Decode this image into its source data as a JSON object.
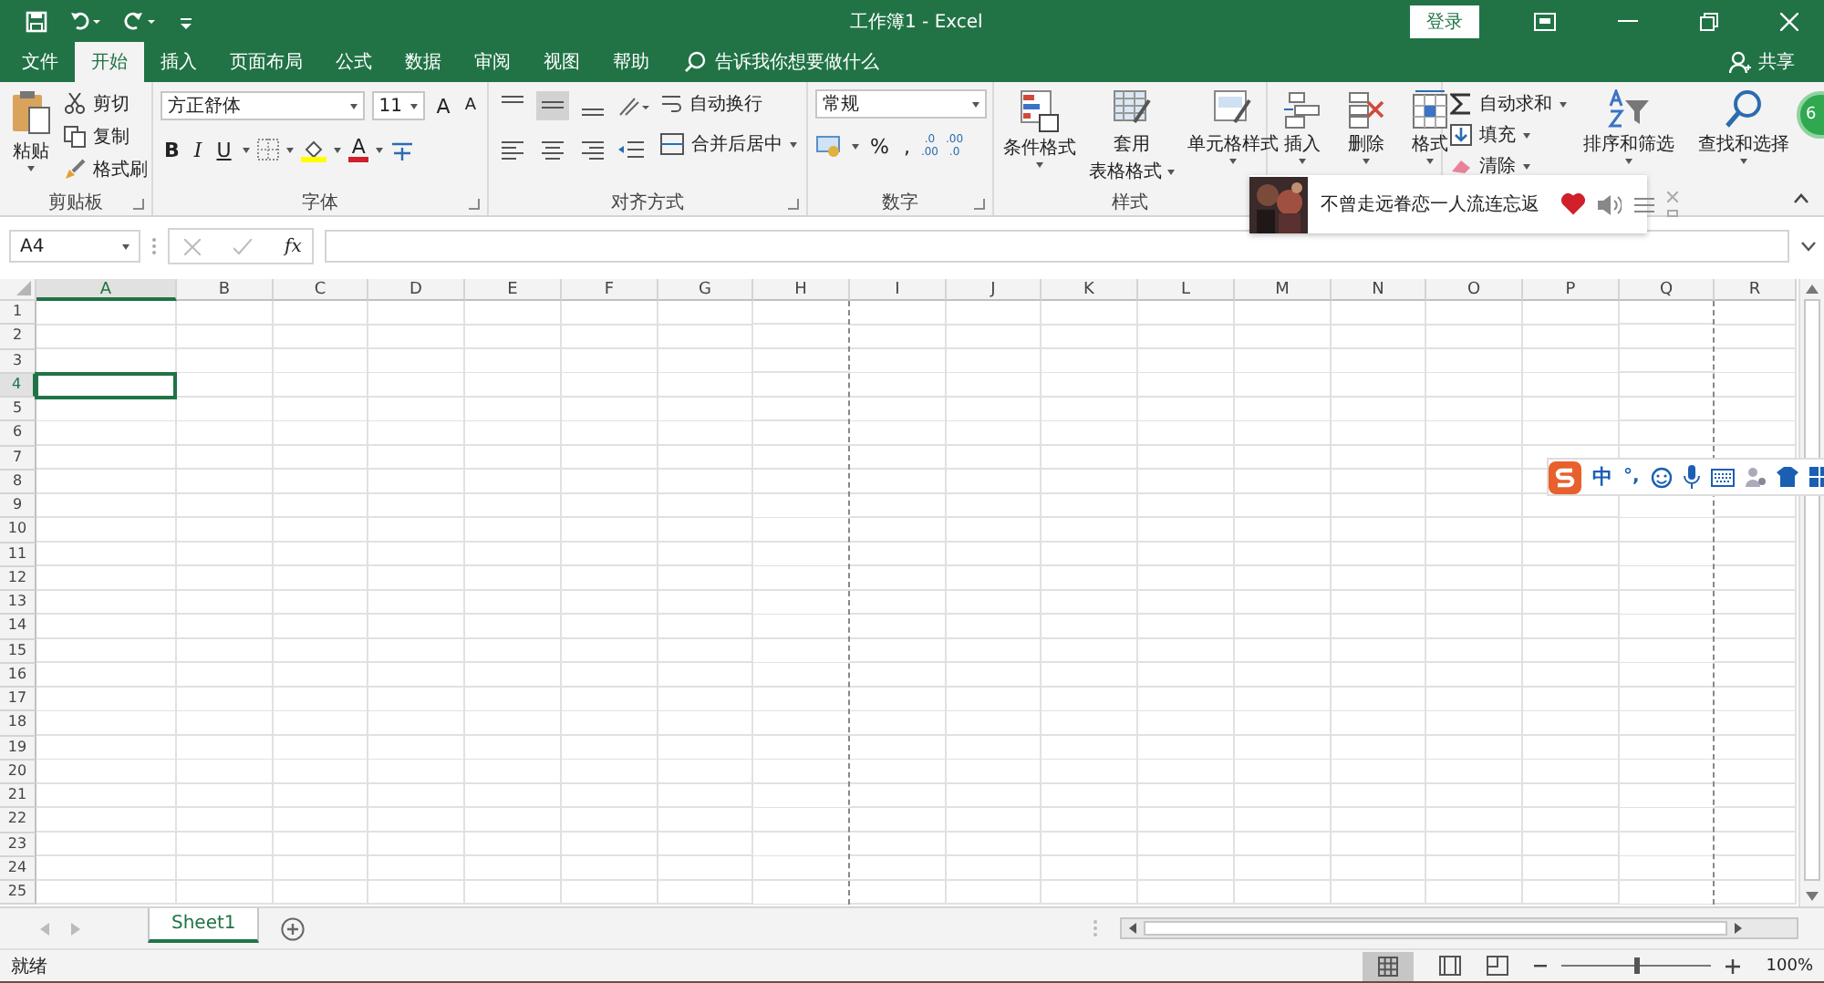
{
  "title_bar": {
    "title": "工作簿1  -  Excel",
    "login": "登录"
  },
  "tabs": [
    {
      "label": "文件",
      "selected": false
    },
    {
      "label": "开始",
      "selected": true
    },
    {
      "label": "插入",
      "selected": false
    },
    {
      "label": "页面布局",
      "selected": false
    },
    {
      "label": "公式",
      "selected": false
    },
    {
      "label": "数据",
      "selected": false
    },
    {
      "label": "审阅",
      "selected": false
    },
    {
      "label": "视图",
      "selected": false
    },
    {
      "label": "帮助",
      "selected": false
    }
  ],
  "tell_me": "告诉我你想要做什么",
  "share": "共享",
  "ribbon": {
    "clipboard": {
      "paste": "粘贴",
      "cut": "剪切",
      "copy": "复制",
      "format_painter": "格式刷",
      "label": "剪贴板"
    },
    "font": {
      "name": "方正舒体",
      "size": "11",
      "grow": "A",
      "shrink": "A",
      "bold": "B",
      "italic": "I",
      "underline": "U",
      "font_color_letter": "A",
      "label": "字体"
    },
    "alignment": {
      "wrap": "自动换行",
      "merge": "合并后居中",
      "label": "对齐方式"
    },
    "number": {
      "format": "常规",
      "percent": "%",
      "comma": ",",
      "decimals": [
        {
          "top": ".0",
          "bottom": ".00"
        },
        {
          "top": ".00",
          "bottom": ".0"
        }
      ],
      "label": "数字"
    },
    "styles": {
      "conditional": "条件格式",
      "table_1": "套用",
      "table_2": "表格格式",
      "cell_styles": "单元格样式",
      "label": "样式"
    },
    "cells": {
      "insert": "插入",
      "delete": "删除",
      "format": "格式"
    },
    "editing": {
      "autosum": "自动求和",
      "fill": "填充",
      "clear": "清除",
      "sort": "排序和筛选",
      "find": "查找和选择"
    }
  },
  "badge": "6",
  "music_popup": {
    "song": "不曾走远眷恋一人流连忘返",
    "liked": true
  },
  "formula_bar": {
    "name_box": "A4",
    "fx": "fx"
  },
  "columns": [
    {
      "label": "A",
      "selected": true,
      "page_break": false
    },
    {
      "label": "B",
      "selected": false,
      "page_break": false
    },
    {
      "label": "C",
      "selected": false,
      "page_break": false
    },
    {
      "label": "D",
      "selected": false,
      "page_break": false
    },
    {
      "label": "E",
      "selected": false,
      "page_break": false
    },
    {
      "label": "F",
      "selected": false,
      "page_break": false
    },
    {
      "label": "G",
      "selected": false,
      "page_break": false
    },
    {
      "label": "H",
      "selected": false,
      "page_break": true
    },
    {
      "label": "I",
      "selected": false,
      "page_break": false
    },
    {
      "label": "J",
      "selected": false,
      "page_break": false
    },
    {
      "label": "K",
      "selected": false,
      "page_break": false
    },
    {
      "label": "L",
      "selected": false,
      "page_break": false
    },
    {
      "label": "M",
      "selected": false,
      "page_break": false
    },
    {
      "label": "N",
      "selected": false,
      "page_break": false
    },
    {
      "label": "O",
      "selected": false,
      "page_break": false
    },
    {
      "label": "P",
      "selected": false,
      "page_break": false
    },
    {
      "label": "Q",
      "selected": false,
      "page_break": true
    },
    {
      "label": "R",
      "selected": false,
      "page_break": false
    }
  ],
  "rows": [
    {
      "label": "1",
      "selected": false
    },
    {
      "label": "2",
      "selected": false
    },
    {
      "label": "3",
      "selected": false
    },
    {
      "label": "4",
      "selected": true
    },
    {
      "label": "5",
      "selected": false
    },
    {
      "label": "6",
      "selected": false
    },
    {
      "label": "7",
      "selected": false
    },
    {
      "label": "8",
      "selected": false
    },
    {
      "label": "9",
      "selected": false
    },
    {
      "label": "10",
      "selected": false
    },
    {
      "label": "11",
      "selected": false
    },
    {
      "label": "12",
      "selected": false
    },
    {
      "label": "13",
      "selected": false
    },
    {
      "label": "14",
      "selected": false
    },
    {
      "label": "15",
      "selected": false
    },
    {
      "label": "16",
      "selected": false
    },
    {
      "label": "17",
      "selected": false
    },
    {
      "label": "18",
      "selected": false
    },
    {
      "label": "19",
      "selected": false
    },
    {
      "label": "20",
      "selected": false
    },
    {
      "label": "21",
      "selected": false
    },
    {
      "label": "22",
      "selected": false
    },
    {
      "label": "23",
      "selected": false
    },
    {
      "label": "24",
      "selected": false
    },
    {
      "label": "25",
      "selected": false
    }
  ],
  "ime_bar": {
    "mode": "中",
    "punct": "°,"
  },
  "sheets": [
    {
      "label": "Sheet1",
      "selected": true
    }
  ],
  "status_bar": {
    "text": "就绪",
    "zoom": "100%",
    "level": 0.5
  }
}
